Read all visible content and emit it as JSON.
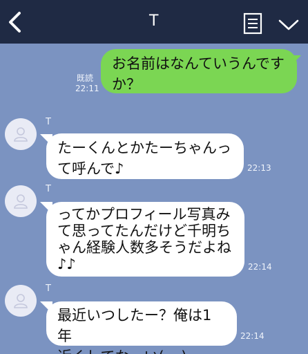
{
  "header": {
    "title": "T",
    "back_icon": "chevron-left-icon",
    "notes_icon": "notes-icon",
    "menu_icon": "chevron-down-icon"
  },
  "messages": [
    {
      "direction": "outgoing",
      "lines": [
        "お名前はなんていうんです",
        "か？"
      ],
      "read_label": "既読",
      "time": "22:11"
    },
    {
      "direction": "incoming",
      "sender": "T",
      "lines": [
        "たーくんとかたーちゃんっ",
        "て呼んで♪"
      ],
      "time": "22:13"
    },
    {
      "direction": "incoming",
      "sender": "T",
      "lines": [
        "ってかプロフィール写真み",
        "て思ってたんだけど千明ち",
        "ゃん経験人数多そうだよね",
        "♪♪"
      ],
      "time": "22:14"
    },
    {
      "direction": "incoming",
      "sender": "T",
      "lines": [
        "最近いつしたー？俺は1年",
        "近くしてなーい(;_;)"
      ],
      "time": "22:14"
    }
  ],
  "colors": {
    "background": "#7b93c1",
    "header": "#1f2a44",
    "outgoing_bubble": "#7bd653",
    "incoming_bubble": "#ffffff"
  }
}
